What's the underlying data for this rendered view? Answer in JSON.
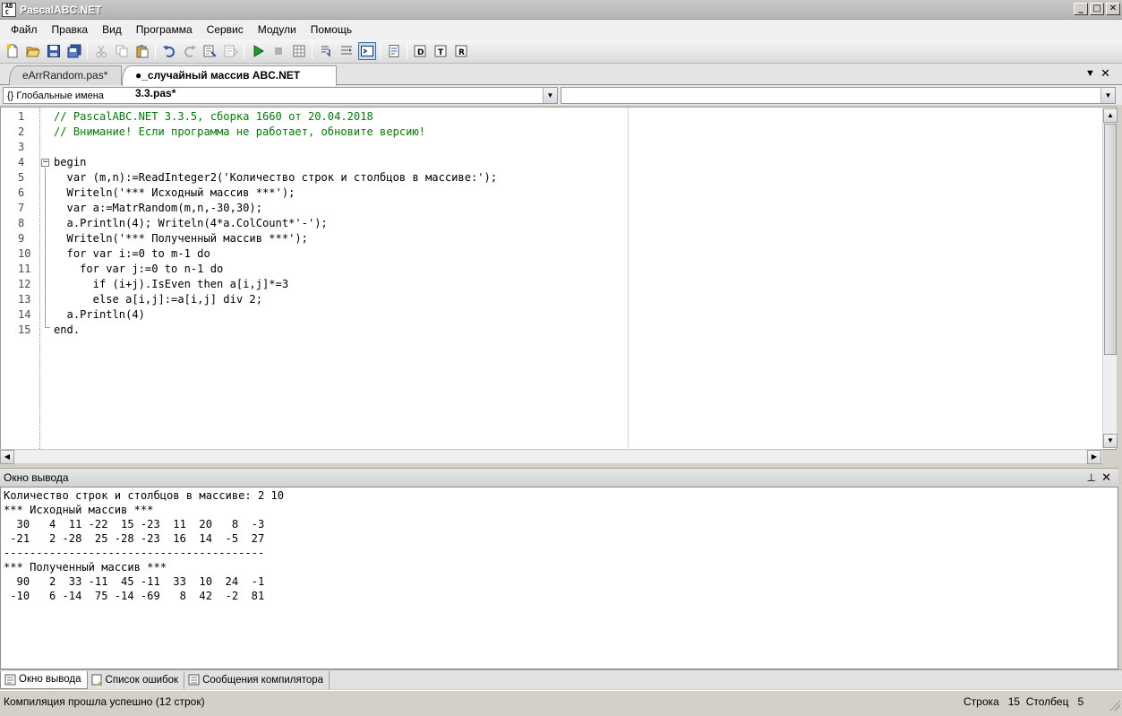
{
  "window": {
    "title": "PascalABC.NET"
  },
  "menu": [
    "Файл",
    "Правка",
    "Вид",
    "Программа",
    "Сервис",
    "Модули",
    "Помощь"
  ],
  "tabs": [
    {
      "label": "eArrRandom.pas*",
      "active": false
    },
    {
      "label": "●_случайный массив ABC.NET 3.3.pas*",
      "active": true
    }
  ],
  "navigation": {
    "left_combo": "{} Глобальные имена",
    "right_combo": ""
  },
  "editor": {
    "line_numbers": [
      "1",
      "2",
      "3",
      "4",
      "5",
      "6",
      "7",
      "8",
      "9",
      "10",
      "11",
      "12",
      "13",
      "14",
      "15"
    ],
    "lines": [
      {
        "text": "// PascalABC.NET 3.3.5, сборка 1660 от 20.04.2018",
        "kind": "comment"
      },
      {
        "text": "// Внимание! Если программа не работает, обновите версию!",
        "kind": "comment"
      },
      {
        "text": "",
        "kind": "blank"
      },
      {
        "text": "begin",
        "kind": "keyword"
      },
      {
        "text": "  var (m,n):=ReadInteger2('Количество строк и столбцов в массиве:');",
        "kind": "code"
      },
      {
        "text": "  Writeln('*** Исходный массив ***');",
        "kind": "code"
      },
      {
        "text": "  var a:=MatrRandom(m,n,-30,30);",
        "kind": "code"
      },
      {
        "text": "  a.Println(4); Writeln(4*a.ColCount*'-');",
        "kind": "code"
      },
      {
        "text": "  Writeln('*** Полученный массив ***');",
        "kind": "code"
      },
      {
        "text": "  for var i:=0 to m-1 do",
        "kind": "code"
      },
      {
        "text": "    for var j:=0 to n-1 do",
        "kind": "code"
      },
      {
        "text": "      if (i+j).IsEven then a[i,j]*=3",
        "kind": "code"
      },
      {
        "text": "      else a[i,j]:=a[i,j] div 2;",
        "kind": "code"
      },
      {
        "text": "  a.Println(4)",
        "kind": "code"
      },
      {
        "text": "end.",
        "kind": "keyword"
      }
    ]
  },
  "output_panel": {
    "title": "Окно вывода",
    "pin_icon": "pin-icon",
    "close_icon": "close-icon",
    "lines": [
      "Количество строк и столбцов в массиве: 2 10",
      "*** Исходный массив ***",
      "  30   4  11 -22  15 -23  11  20   8  -3",
      " -21   2 -28  25 -28 -23  16  14  -5  27",
      "----------------------------------------",
      "*** Полученный массив ***",
      "  90   2  33 -11  45 -11  33  10  24  -1",
      " -10   6 -14  75 -14 -69   8  42  -2  81"
    ]
  },
  "bottom_tabs": [
    {
      "label": "Окно вывода",
      "active": true
    },
    {
      "label": "Список ошибок",
      "active": false
    },
    {
      "label": "Сообщения компилятора",
      "active": false
    }
  ],
  "status": {
    "message": "Компиляция прошла успешно (12 строк)",
    "position": "Строка   15  Столбец   5"
  },
  "colors": {
    "comment": "#008000",
    "string": "#0000ff",
    "accent": "#3c6ea8"
  }
}
